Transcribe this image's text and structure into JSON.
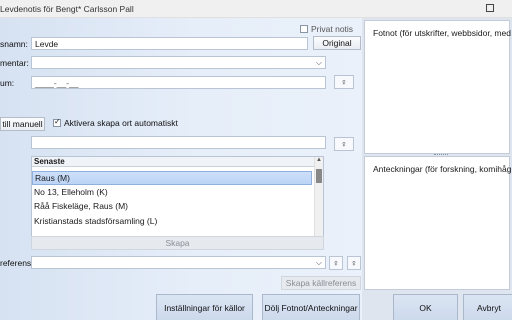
{
  "window": {
    "title": "Levdenotis för Bengt* Carlsson Pall"
  },
  "form": {
    "private_label": "Privat notis",
    "name_label": "snamn:",
    "name_value": "Levde",
    "original_button": "Original",
    "comment_label": "mentar:",
    "date_label": "um:",
    "date_value": "____-__-__",
    "switch_manual_button": "till manuell",
    "auto_create_label": "Aktivera skapa ort automatiskt",
    "create_button": "Skapa",
    "reference_label": "referens:",
    "create_source_ref_button": "Skapa källreferens"
  },
  "places": {
    "header": "Senaste",
    "rows": [
      "Raus (M)",
      "No 13, Elleholm (K)",
      "Råå Fiskeläge, Raus (M)",
      "Kristianstads stadsförsamling (L)"
    ],
    "selected_index": 0
  },
  "right": {
    "footnote_title": "Fotnot (för utskrifter, webbsidor, med m",
    "notes_title": "Anteckningar (för forskning, komihåg, o"
  },
  "buttons": {
    "source_settings": "Inställningar för källor",
    "hide_footnote": "Dölj Fotnot/Anteckningar",
    "ok": "OK",
    "cancel": "Avbryt"
  },
  "icons": {
    "hint": "lightbulb-icon",
    "dropdown": "chevron-down-icon",
    "checkbox": "checkmark-icon",
    "maximize": "maximize-icon"
  }
}
